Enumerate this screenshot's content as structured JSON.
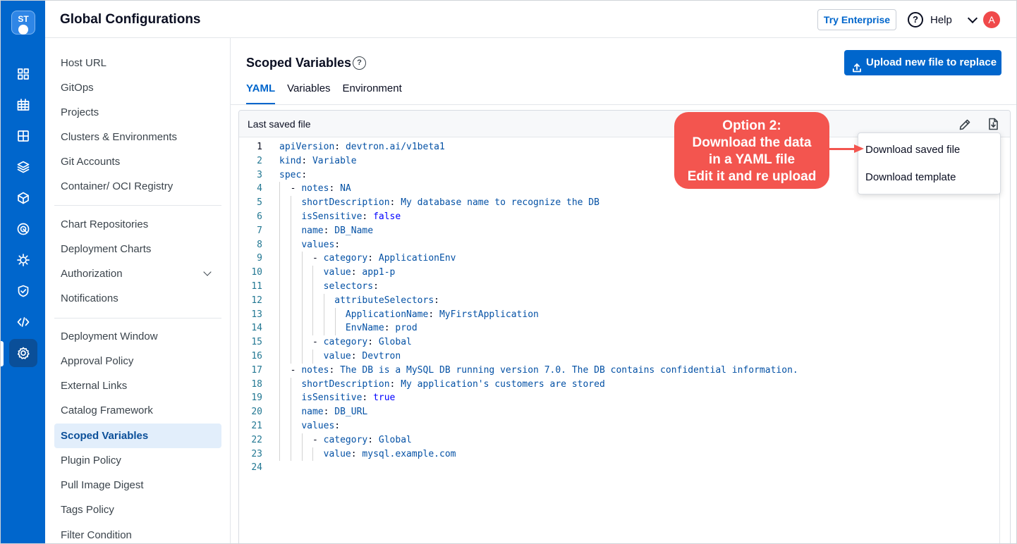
{
  "app": {
    "logo_text": "ST",
    "page_title": "Global Configurations",
    "try_enterprise": "Try Enterprise",
    "help": "Help",
    "avatar_letter": "A",
    "brand_color": "#0066cc"
  },
  "rail": {
    "items": [
      "grid-icon",
      "table-icon",
      "apps-icon",
      "layers-icon",
      "cube-icon",
      "target-icon",
      "gear-bug-icon",
      "shield-check-icon",
      "code-icon",
      "settings-icon"
    ]
  },
  "subnav": {
    "group1": [
      "Host URL",
      "GitOps",
      "Projects",
      "Clusters & Environments",
      "Git Accounts",
      "Container/ OCI Registry"
    ],
    "group2": [
      "Chart Repositories",
      "Deployment Charts",
      "Authorization",
      "Notifications"
    ],
    "group3": [
      "Deployment Window",
      "Approval Policy",
      "External Links",
      "Catalog Framework",
      "Scoped Variables",
      "Plugin Policy",
      "Pull Image Digest",
      "Tags Policy",
      "Filter Condition"
    ]
  },
  "main": {
    "title": "Scoped Variables",
    "upload_button": "Upload new file to replace",
    "tabs": [
      "YAML",
      "Variables",
      "Environment"
    ],
    "panel_title": "Last saved file"
  },
  "code": [
    "apiVersion: devtron.ai/v1beta1",
    "kind: Variable",
    "spec:",
    "  - notes: NA",
    "    shortDescription: My database name to recognize the DB",
    "    isSensitive: false",
    "    name: DB_Name",
    "    values:",
    "      - category: ApplicationEnv",
    "        value: app1-p",
    "        selectors:",
    "          attributeSelectors:",
    "            ApplicationName: MyFirstApplication",
    "            EnvName: prod",
    "      - category: Global",
    "        value: Devtron",
    "  - notes: The DB is a MySQL DB running version 7.0. The DB contains confidential information.",
    "    shortDescription: My application's customers are stored",
    "    isSensitive: true",
    "    name: DB_URL",
    "    values:",
    "      - category: Global",
    "        value: mysql.example.com",
    ""
  ],
  "dropdown": [
    "Download saved file",
    "Download template"
  ],
  "callout": [
    "Option 2:",
    "Download the data",
    "in a YAML file",
    "Edit it and re upload"
  ],
  "callout_color": "#f3554f"
}
